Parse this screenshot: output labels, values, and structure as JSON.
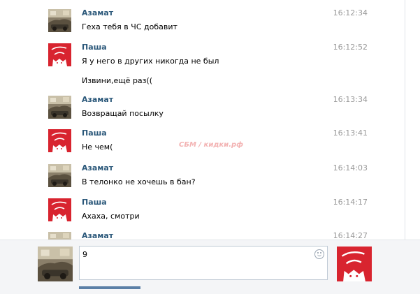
{
  "messages": [
    {
      "author": "Азамат",
      "time": "16:12:34",
      "avatar": "azamat",
      "lines": [
        "Геха тебя в ЧС добавит"
      ]
    },
    {
      "author": "Паша",
      "time": "16:12:52",
      "avatar": "pasha",
      "lines": [
        "Я у него в других никогда не был",
        "Извини,ещё раз(("
      ]
    },
    {
      "author": "Азамат",
      "time": "16:13:34",
      "avatar": "azamat",
      "lines": [
        "Возвращай посылку"
      ]
    },
    {
      "author": "Паша",
      "time": "16:13:41",
      "avatar": "pasha",
      "lines": [
        "Не чем("
      ]
    },
    {
      "author": "Азамат",
      "time": "16:14:03",
      "avatar": "azamat",
      "lines": [
        "В телонко не хочешь в бан?"
      ]
    },
    {
      "author": "Паша",
      "time": "16:14:17",
      "avatar": "pasha",
      "lines": [
        "Ахаха, смотри"
      ]
    },
    {
      "author": "Азамат",
      "time": "16:14:27",
      "avatar": "azamat",
      "lines": []
    }
  ],
  "watermark": "СБМ / кидки.рф",
  "composer": {
    "input_value": "9",
    "emoji_icon": "smiley-icon"
  },
  "colors": {
    "author": "#2b587a",
    "time": "#999999",
    "pasha_avatar_bg": "#d8242f",
    "watermark": "#f3b3b3",
    "input_border": "#c0cad5"
  }
}
